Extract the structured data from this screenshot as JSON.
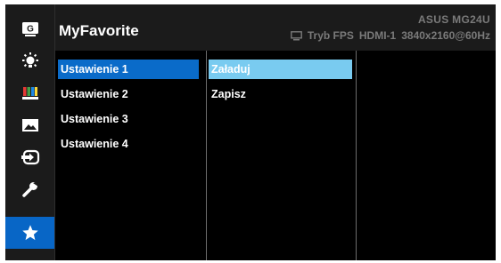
{
  "header": {
    "title": "MyFavorite",
    "model": "ASUS  MG24U",
    "mode": "Tryb FPS",
    "input": "HDMI-1",
    "resolution": "3840x2160@60Hz"
  },
  "sidebar": {
    "items": [
      {
        "icon": "gameplus-icon",
        "label": "G"
      },
      {
        "icon": "brightness-icon"
      },
      {
        "icon": "color-icon"
      },
      {
        "icon": "image-icon"
      },
      {
        "icon": "input-select-icon"
      },
      {
        "icon": "system-setup-icon"
      },
      {
        "icon": "star-icon",
        "active": true
      }
    ]
  },
  "settings_list": [
    "Ustawienie 1",
    "Ustawienie 2",
    "Ustawienie 3",
    "Ustawienie 4"
  ],
  "actions_list": [
    "Załaduj",
    "Zapisz"
  ],
  "colors": {
    "osd_bg": "#000000",
    "panel_bg": "#1b1b1b",
    "selected_primary": "#0a6bc9",
    "selected_secondary": "#79cbf0",
    "text": "#ffffff",
    "status_text": "#7a7a7a"
  }
}
